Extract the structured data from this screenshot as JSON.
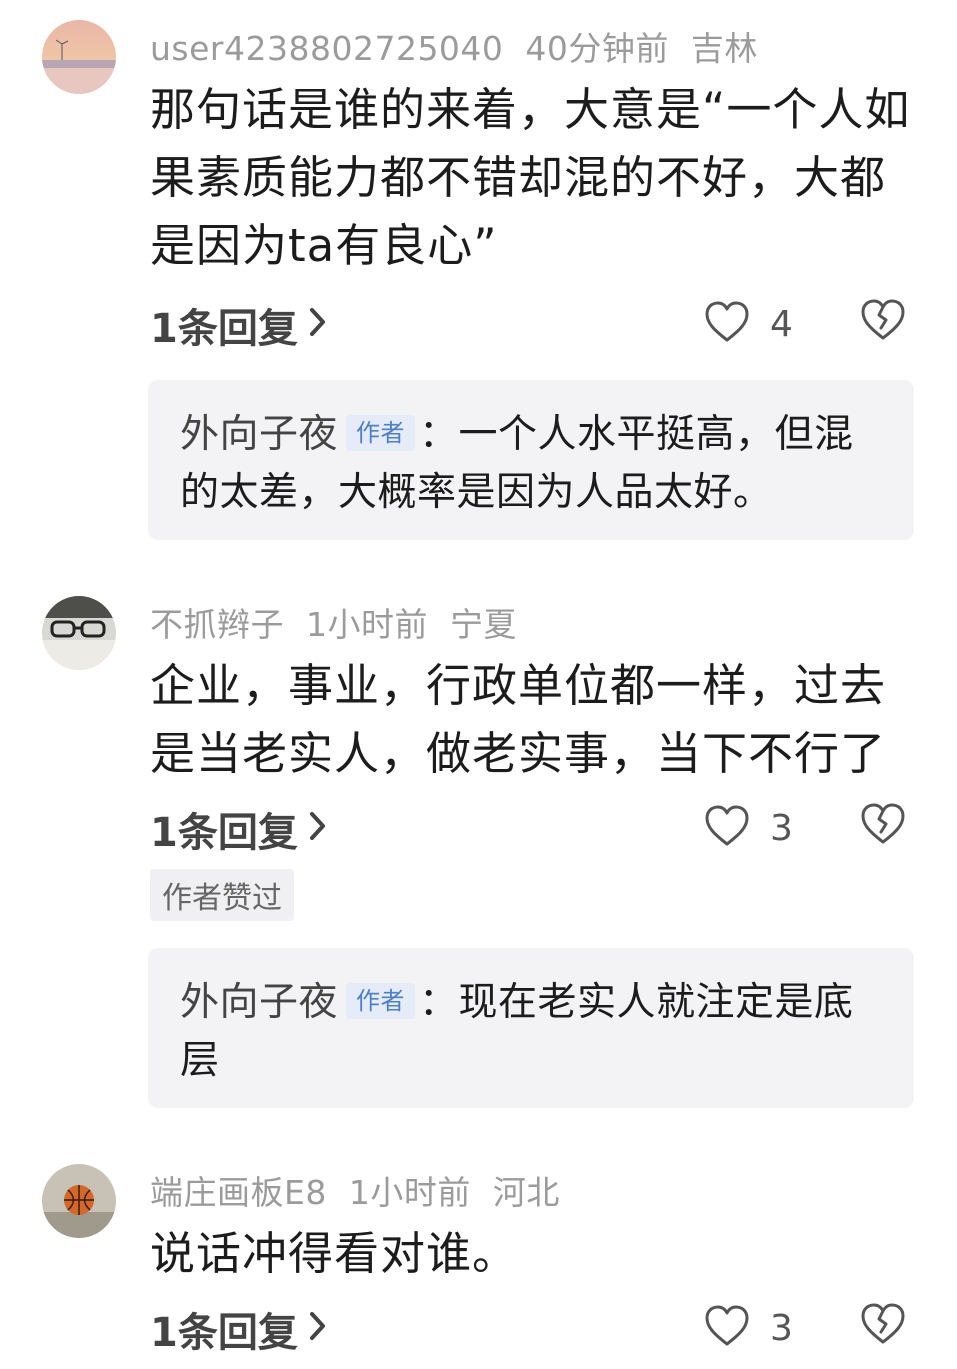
{
  "comments": [
    {
      "username": "user4238802725040",
      "time": "40分钟前",
      "location": "吉林",
      "text": "那句话是谁的来着，大意是“一个人如果素质能力都不错却混的不好，大都是因为ta有良心”",
      "reply_link": "1条回复",
      "likes": "4",
      "reply": {
        "author": "外向子夜",
        "tag": "作者",
        "text": "：一个人水平挺高，但混的太差，大概率是因为人品太好。"
      }
    },
    {
      "username": "不抓辫子",
      "time": "1小时前",
      "location": "宁夏",
      "text": "企业，事业，行政单位都一样，过去是当老实人，做老实事，当下不行了",
      "reply_link": "1条回复",
      "likes": "3",
      "badge": "作者赞过",
      "reply": {
        "author": "外向子夜",
        "tag": "作者",
        "text": "：现在老实人就注定是底层"
      }
    },
    {
      "username": "端庄画板E8",
      "time": "1小时前",
      "location": "河北",
      "text": "说话冲得看对谁。",
      "reply_link": "1条回复",
      "likes": "3"
    }
  ],
  "icons": {
    "like": "heart-outline-icon",
    "dislike": "broken-heart-icon",
    "chevron": "chevron-right-icon"
  }
}
